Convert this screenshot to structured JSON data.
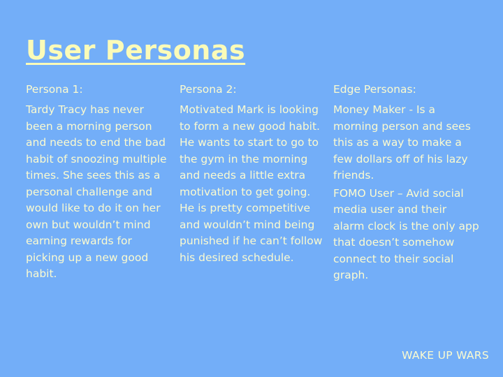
{
  "title": "User Personas",
  "columns": [
    {
      "heading": "Persona 1:",
      "paragraphs": [
        "Tardy Tracy has never been a morning person and needs to end the bad habit of snoozing multiple times. She sees this as a personal challenge and would like to do it on her own but wouldn’t mind earning rewards for picking up a new good habit."
      ]
    },
    {
      "heading": "Persona 2:",
      "paragraphs": [
        "Motivated Mark is looking to form a new good habit. He wants to start to go to the gym in the morning and needs a little extra motivation to get going. He is pretty competitive and wouldn’t mind being punished if he can’t follow his desired schedule."
      ]
    },
    {
      "heading": "Edge Personas:",
      "paragraphs": [
        "Money Maker - Is a morning person and sees this as a way to make a few dollars off of his lazy friends.",
        "FOMO User – Avid social media user and their alarm clock is the only app that doesn’t somehow connect to their social graph."
      ]
    }
  ],
  "footer": "WAKE UP WARS",
  "colors": {
    "background": "#73aef8",
    "title": "#fbfbb8",
    "text": "#fbfbd0"
  }
}
